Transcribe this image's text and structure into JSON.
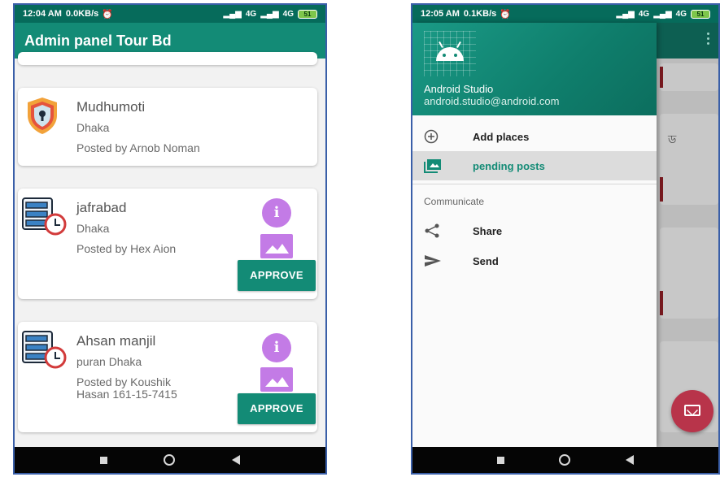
{
  "left": {
    "status": {
      "time": "12:04 AM",
      "speed": "0.0KB/s",
      "network": "4G",
      "network2": "4G",
      "battery": "51"
    },
    "app_title": "Admin panel Tour Bd",
    "cards": [
      {
        "title": "Mudhumoti",
        "location": "Dhaka",
        "poster": "Posted by Arnob Noman"
      },
      {
        "title": "jafrabad",
        "location": "Dhaka",
        "poster": "Posted by Hex Aion",
        "approve_label": "APPROVE",
        "info_label": "i"
      },
      {
        "title": "Ahsan manjil",
        "location": "puran Dhaka",
        "poster_line1": "Posted by Koushik",
        "poster_line2": "Hasan 161-15-7415",
        "approve_label": "APPROVE",
        "info_label": "i"
      }
    ],
    "icons": {
      "card1": "shield-keyhole-icon",
      "card2": "server-clock-icon",
      "card3": "server-clock-icon",
      "info": "info-icon",
      "image": "image-icon"
    },
    "colors": {
      "primary": "#138b76",
      "accent": "#c37be6"
    }
  },
  "right": {
    "status": {
      "time": "12:05 AM",
      "speed": "0.1KB/s",
      "network": "4G",
      "network2": "4G",
      "battery": "51"
    },
    "drawer": {
      "user_name": "Android Studio",
      "user_email": "android.studio@android.com",
      "items": [
        {
          "label": "Add places",
          "icon": "add-circle-icon"
        },
        {
          "label": "pending posts",
          "icon": "photo-library-icon"
        }
      ],
      "section_label": "Communicate",
      "comm_items": [
        {
          "label": "Share",
          "icon": "share-icon"
        },
        {
          "label": "Send",
          "icon": "send-icon"
        }
      ]
    },
    "background_fragment": "ড",
    "fab_icon": "email-icon"
  }
}
